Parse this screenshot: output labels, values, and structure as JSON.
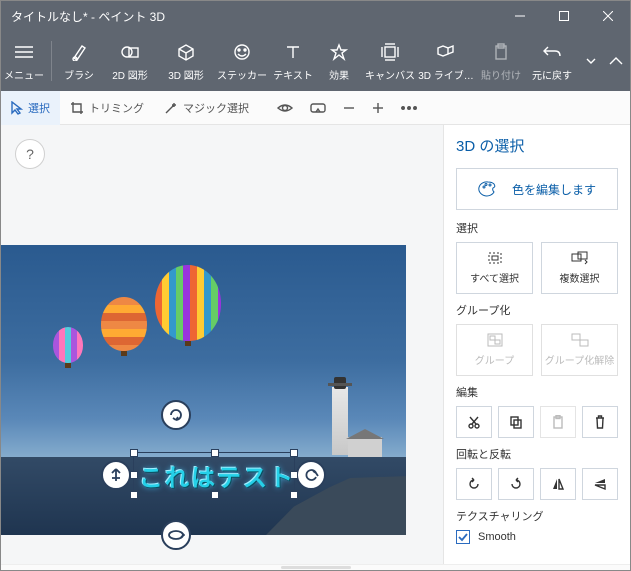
{
  "titlebar": {
    "title": "タイトルなし* - ペイント 3D"
  },
  "ribbon": {
    "menu": "メニュー",
    "brush": "ブラシ",
    "shapes2d": "2D 図形",
    "shapes3d": "3D 図形",
    "stickers": "ステッカー",
    "text": "テキスト",
    "effects": "効果",
    "canvas": "キャンバス",
    "lib3d": "3D ライブ…",
    "paste": "貼り付け",
    "undo": "元に戻す"
  },
  "sectoolbar": {
    "select": "選択",
    "crop": "トリミング",
    "magic": "マジック選択"
  },
  "sidepanel": {
    "title": "3D の選択",
    "edit_color": "色を編集します",
    "section_select": "選択",
    "select_all": "すべて選択",
    "multiselect": "複数選択",
    "section_group": "グループ化",
    "group": "グループ",
    "ungroup": "グループ化解除",
    "section_edit": "編集",
    "section_rotate": "回転と反転",
    "section_texture": "テクスチャリング",
    "smooth": "Smooth"
  },
  "canvas": {
    "text3d": "これはテスト"
  },
  "help": "?"
}
